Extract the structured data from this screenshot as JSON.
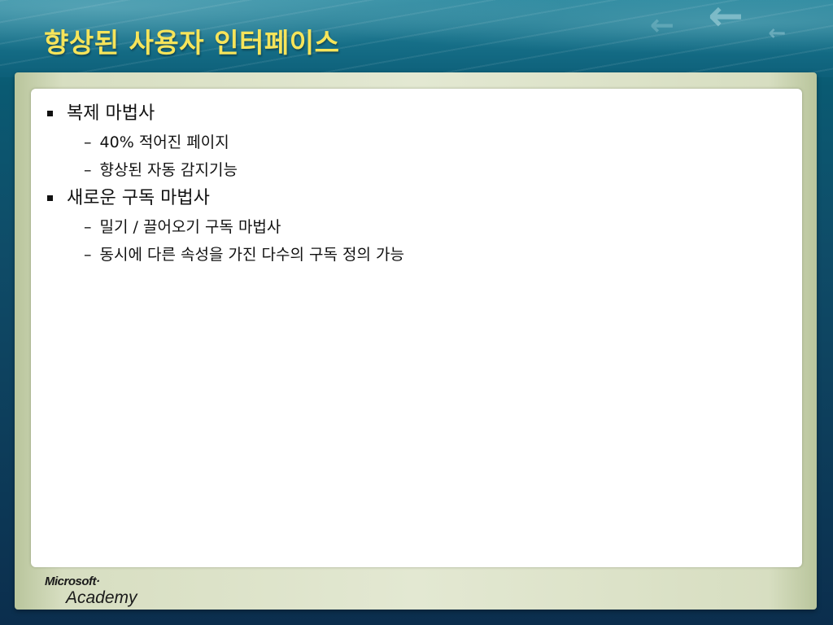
{
  "slide": {
    "title": "향상된 사용자 인터페이스",
    "bullets": [
      {
        "text": "복제 마법사",
        "sub": [
          "40% 적어진 페이지",
          "향상된 자동 감지기능"
        ]
      },
      {
        "text": "새로운 구독 마법사",
        "sub": [
          "밀기 / 끌어오기 구독 마법사",
          "동시에 다른 속성을 가진 다수의 구독 정의 가능"
        ]
      }
    ],
    "dash": "–"
  },
  "logo": {
    "brand": "Microsoft",
    "mark": "·",
    "product": "Academy"
  },
  "icons": {
    "arrow": "←"
  },
  "colors": {
    "title": "#f6e45a",
    "background": "#0f4c68",
    "panel": "#ffffff",
    "frame": "#d7dec1"
  }
}
